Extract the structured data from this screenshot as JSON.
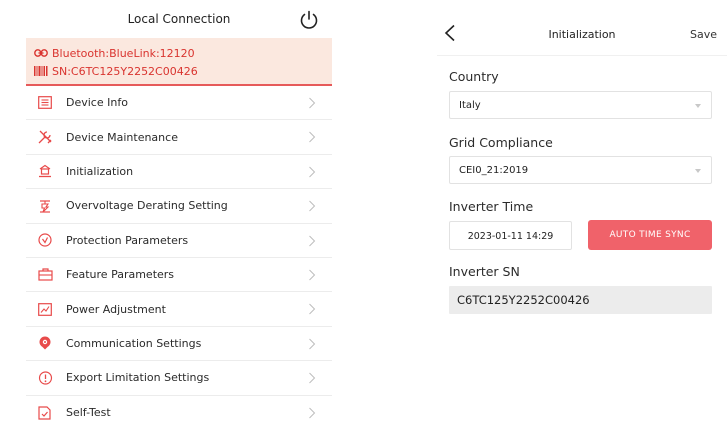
{
  "left": {
    "title": "Local Connection",
    "connection": {
      "bluetooth": "Bluetooth:BlueLink:12120",
      "sn": "SN:C6TC125Y2252C00426"
    },
    "menu": [
      {
        "label": "Device Info",
        "icon": "device-info-icon"
      },
      {
        "label": "Device Maintenance",
        "icon": "wrench-icon"
      },
      {
        "label": "Initialization",
        "icon": "initialization-icon"
      },
      {
        "label": "Overvoltage Derating Setting",
        "icon": "overvoltage-icon"
      },
      {
        "label": "Protection Parameters",
        "icon": "protection-icon"
      },
      {
        "label": "Feature Parameters",
        "icon": "feature-icon"
      },
      {
        "label": "Power Adjustment",
        "icon": "power-adjustment-icon"
      },
      {
        "label": "Communication Settings",
        "icon": "communication-icon"
      },
      {
        "label": "Export Limitation Settings",
        "icon": "export-limit-icon"
      },
      {
        "label": "Self-Test",
        "icon": "self-test-icon"
      }
    ]
  },
  "right": {
    "title": "Initialization",
    "save_label": "Save",
    "country_label": "Country",
    "country_value": "Italy",
    "grid_label": "Grid Compliance",
    "grid_value": "CEI0_21:2019",
    "time_label": "Inverter Time",
    "time_value": "2023-01-11 14:29",
    "sync_label": "AUTO TIME SYNC",
    "sn_label": "Inverter SN",
    "sn_value": "C6TC125Y2252C00426"
  },
  "colors": {
    "accent": "#e84a4a",
    "connection_bg": "#fbe8df",
    "sync_button": "#f0626a"
  }
}
